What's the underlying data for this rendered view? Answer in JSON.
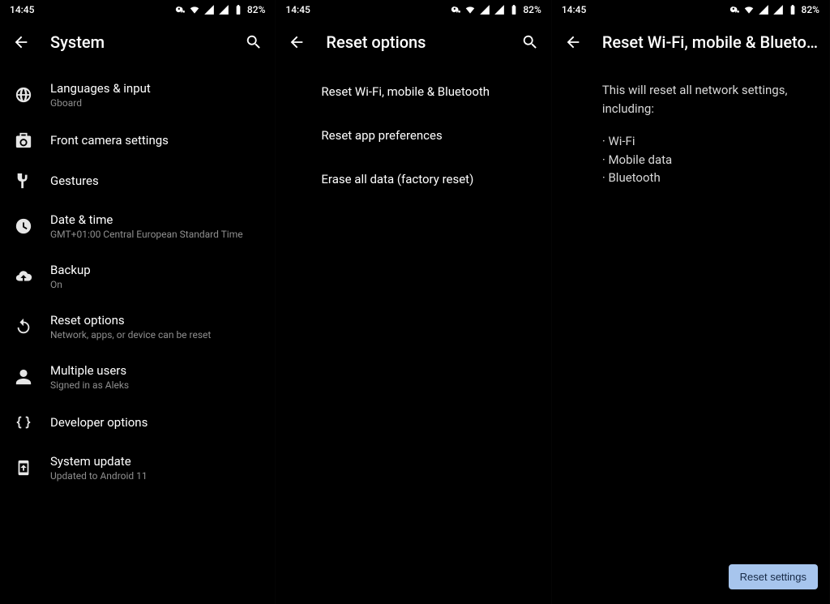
{
  "status": {
    "time": "14:45",
    "battery": "82%"
  },
  "screen1": {
    "title": "System",
    "items": [
      {
        "icon": "globe",
        "primary": "Languages & input",
        "secondary": "Gboard"
      },
      {
        "icon": "camera",
        "primary": "Front camera settings",
        "secondary": ""
      },
      {
        "icon": "gesture",
        "primary": "Gestures",
        "secondary": ""
      },
      {
        "icon": "clock",
        "primary": "Date & time",
        "secondary": "GMT+01:00 Central European Standard Time"
      },
      {
        "icon": "backup",
        "primary": "Backup",
        "secondary": "On"
      },
      {
        "icon": "reset",
        "primary": "Reset options",
        "secondary": "Network, apps, or device can be reset"
      },
      {
        "icon": "user",
        "primary": "Multiple users",
        "secondary": "Signed in as Aleks"
      },
      {
        "icon": "braces",
        "primary": "Developer options",
        "secondary": ""
      },
      {
        "icon": "update",
        "primary": "System update",
        "secondary": "Updated to Android 11"
      }
    ]
  },
  "screen2": {
    "title": "Reset options",
    "items": [
      {
        "primary": "Reset Wi-Fi, mobile & Bluetooth"
      },
      {
        "primary": "Reset app preferences"
      },
      {
        "primary": "Erase all data (factory reset)"
      }
    ]
  },
  "screen3": {
    "title": "Reset Wi-Fi, mobile & Blueto…",
    "intro": "This will reset all network settings, including:",
    "bullets": [
      "Wi-Fi",
      "Mobile data",
      "Bluetooth"
    ],
    "button": "Reset settings"
  }
}
